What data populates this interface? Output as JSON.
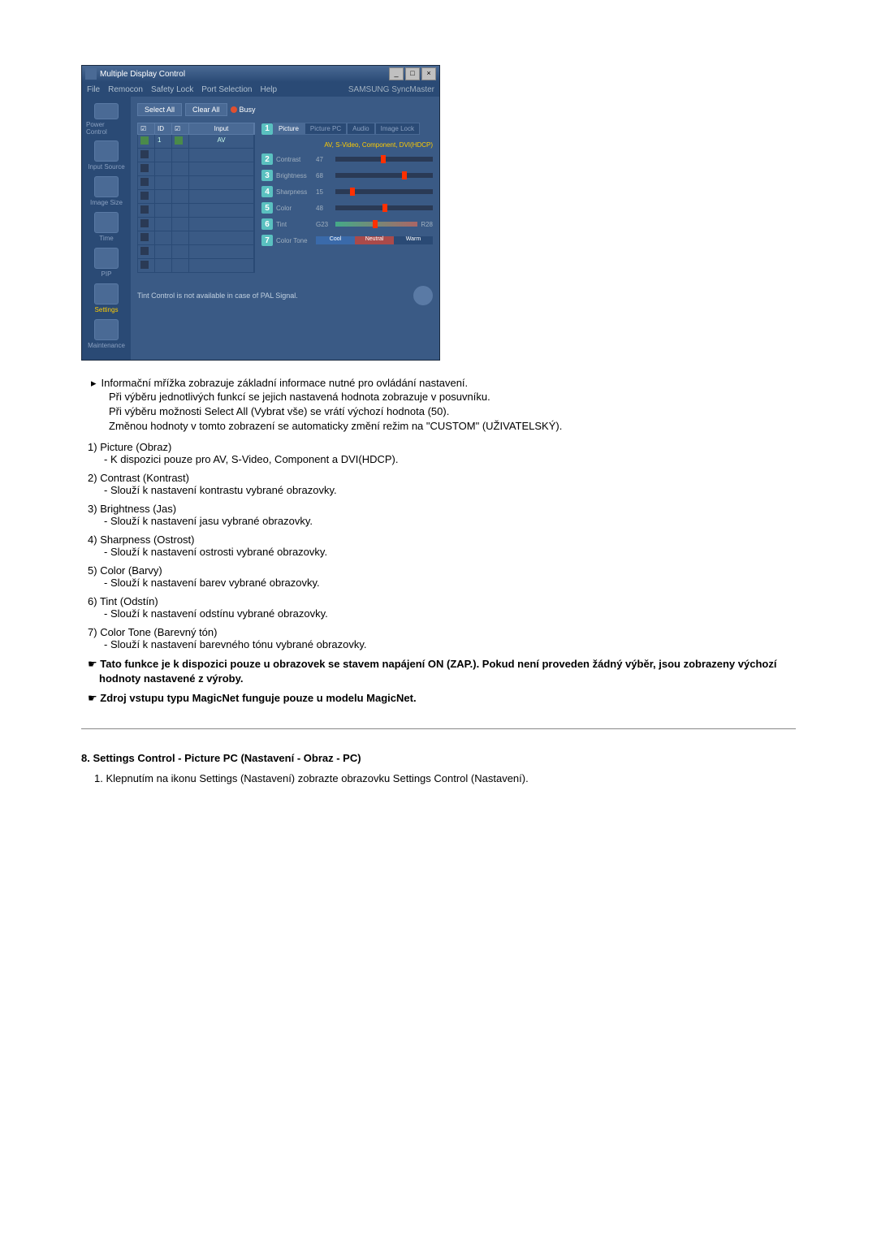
{
  "app": {
    "title": "Multiple Display Control",
    "menubar": [
      "File",
      "Remocon",
      "Safety Lock",
      "Port Selection",
      "Help"
    ],
    "brand": "SAMSUNG SyncMaster"
  },
  "sidebar": {
    "items": [
      {
        "label": "Power Control"
      },
      {
        "label": "Input Source"
      },
      {
        "label": "Image Size"
      },
      {
        "label": "Time"
      },
      {
        "label": "PIP"
      },
      {
        "label": "Settings"
      },
      {
        "label": "Maintenance"
      }
    ]
  },
  "topbuttons": {
    "select_all": "Select All",
    "clear_all": "Clear All",
    "busy": "Busy"
  },
  "grid": {
    "headers": [
      "☑",
      "ID",
      "☑",
      "Input"
    ],
    "row1": {
      "id": "1",
      "input": "AV"
    }
  },
  "tabs": {
    "picture": "Picture",
    "picture_pc": "Picture PC",
    "audio": "Audio",
    "image_lock": "Image Lock"
  },
  "info_line": "AV, S-Video, Component, DVI(HDCP)",
  "sliders": {
    "contrast": {
      "label": "Contrast",
      "value": "47"
    },
    "brightness": {
      "label": "Brightness",
      "value": "68"
    },
    "sharpness": {
      "label": "Sharpness",
      "value": "15"
    },
    "color": {
      "label": "Color",
      "value": "48"
    },
    "tint": {
      "label": "Tint",
      "value": "G23",
      "suffix": "R28"
    },
    "colortone": {
      "label": "Color Tone",
      "cool": "Cool",
      "neutral": "Neutral",
      "warm": "Warm"
    }
  },
  "status_text": "Tint Control is not available in case of PAL Signal.",
  "info_block": [
    "Informační mřížka zobrazuje základní informace nutné pro ovládání nastavení.",
    "Při výběru jednotlivých funkcí se jejich nastavená hodnota zobrazuje v posuvníku.",
    "Při výběru možnosti Select All (Vybrat vše) se vrátí výchozí hodnota (50).",
    "Změnou hodnoty v tomto zobrazení se automaticky změní režim na \"CUSTOM\" (UŽIVATELSKÝ)."
  ],
  "numbered": [
    {
      "n": "1)",
      "title": "Picture (Obraz)",
      "desc": "- K dispozici pouze pro AV, S-Video, Component a DVI(HDCP)."
    },
    {
      "n": "2)",
      "title": "Contrast (Kontrast)",
      "desc": "- Slouží k nastavení kontrastu vybrané obrazovky."
    },
    {
      "n": "3)",
      "title": "Brightness (Jas)",
      "desc": "- Slouží k nastavení jasu vybrané obrazovky."
    },
    {
      "n": "4)",
      "title": "Sharpness (Ostrost)",
      "desc": "- Slouží k nastavení ostrosti vybrané obrazovky."
    },
    {
      "n": "5)",
      "title": "Color (Barvy)",
      "desc": "- Slouží k nastavení barev vybrané obrazovky."
    },
    {
      "n": "6)",
      "title": "Tint (Odstín)",
      "desc": "- Slouží k nastavení odstínu vybrané obrazovky."
    },
    {
      "n": "7)",
      "title": "Color Tone (Barevný tón)",
      "desc": "- Slouží k nastavení barevného tónu vybrané obrazovky."
    }
  ],
  "notes": [
    "Tato funkce je k dispozici pouze u obrazovek se stavem napájení ON (ZAP.). Pokud není proveden žádný výběr, jsou zobrazeny výchozí hodnoty nastavené z výroby.",
    "Zdroj vstupu typu MagicNet funguje pouze u modelu MagicNet."
  ],
  "section8": {
    "title": "8. Settings Control - Picture PC (Nastavení - Obraz - PC)",
    "step1": "1.  Klepnutím na ikonu Settings (Nastavení) zobrazte obrazovku Settings Control (Nastavení)."
  }
}
